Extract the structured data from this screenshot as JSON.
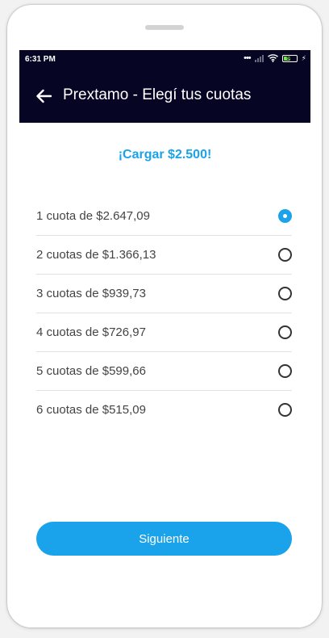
{
  "status_bar": {
    "time": "6:31 PM",
    "signal_dots": "•••",
    "battery_percent": "50",
    "battery_level": 0.5,
    "charging_symbol": "⚡"
  },
  "app_bar": {
    "back_icon": "arrow-left-icon",
    "title": "Prextamo - Elegí tus cuotas"
  },
  "amount_label": "¡Cargar $2.500!",
  "options": [
    {
      "label": "1 cuota de $2.647,09",
      "selected": true
    },
    {
      "label": "2 cuotas de $1.366,13",
      "selected": false
    },
    {
      "label": "3 cuotas de $939,73",
      "selected": false
    },
    {
      "label": "4 cuotas de $726,97",
      "selected": false
    },
    {
      "label": "5 cuotas de $599,66",
      "selected": false
    },
    {
      "label": "6 cuotas de $515,09",
      "selected": false
    }
  ],
  "next_button": {
    "label": "Siguiente"
  },
  "colors": {
    "accent": "#1aa3ea",
    "header_background": "#060523",
    "text": "#444444",
    "divider": "#e2e2e2"
  }
}
